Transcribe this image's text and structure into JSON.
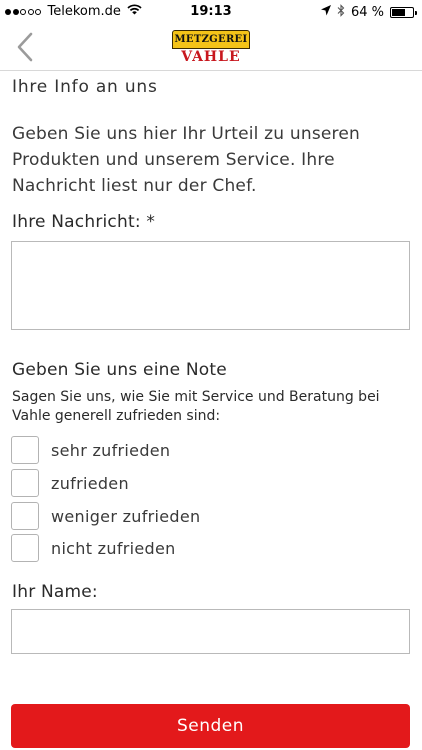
{
  "status_bar": {
    "carrier": "Telekom.de",
    "signal_bars_filled": 2,
    "signal_bars_total": 5,
    "time": "19:13",
    "battery_percent_text": "64 %",
    "battery_level": 0.64,
    "icons": [
      "wifi-icon",
      "location-arrow-icon",
      "bluetooth-icon",
      "battery-icon"
    ]
  },
  "nav": {
    "back_icon": "chevron-left-icon",
    "logo": {
      "top": "METZGEREI",
      "bottom": "VAHLE",
      "colors": {
        "top_bg": "#f4c318",
        "bottom_text": "#c8171e"
      }
    }
  },
  "form": {
    "section_title": "Ihre Info an uns",
    "intro_lines": [
      "Geben Sie uns hier Ihr Urteil zu unseren",
      "Produkten und unserem Service. Ihre",
      "Nachricht liest nur der Chef."
    ],
    "message_label": "Ihre Nachricht: *",
    "message_value": "",
    "rating_title": "Geben Sie uns eine Note",
    "rating_description_lines": [
      "Sagen Sie uns, wie Sie mit Service und Beratung bei",
      "Vahle generell zufrieden sind:"
    ],
    "rating_options": [
      {
        "label": "sehr zufrieden",
        "checked": false
      },
      {
        "label": "zufrieden",
        "checked": false
      },
      {
        "label": "weniger zufrieden",
        "checked": false
      },
      {
        "label": "nicht zufrieden",
        "checked": false
      }
    ],
    "name_label": "Ihr Name:",
    "name_value": "",
    "submit_label": "Senden"
  },
  "colors": {
    "accent": "#e3191b",
    "border": "#b9b9b9"
  }
}
